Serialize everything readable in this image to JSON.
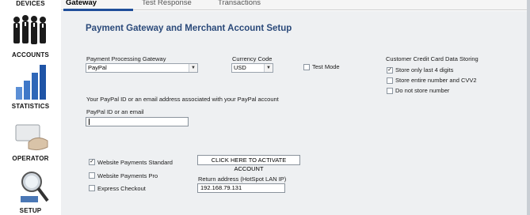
{
  "nav": {
    "items": [
      {
        "label": "DEVICES"
      },
      {
        "label": "ACCOUNTS"
      },
      {
        "label": "STATISTICS"
      },
      {
        "label": "OPERATOR"
      },
      {
        "label": "SETUP"
      }
    ]
  },
  "tabs": [
    {
      "label": "Gateway",
      "active": true
    },
    {
      "label": "Test Response",
      "active": false
    },
    {
      "label": "Transactions",
      "active": false
    }
  ],
  "page": {
    "title": "Payment Gateway and Merchant Account Setup"
  },
  "gateway": {
    "label": "Payment Processing Gateway",
    "value": "PayPal"
  },
  "currency": {
    "label": "Currency Code",
    "value": "USD"
  },
  "test_mode": {
    "label": "Test Mode",
    "checked": false
  },
  "card_storing": {
    "label": "Customer Credit Card Data Storing",
    "options": [
      {
        "label": "Store only last 4 digits",
        "checked": true
      },
      {
        "label": "Store entire number and CVV2",
        "checked": false
      },
      {
        "label": "Do not store number",
        "checked": false
      }
    ]
  },
  "paypal": {
    "instruction": "Your PayPal ID or an email address associated with your PayPal account",
    "id_label": "PayPal ID or an email",
    "id_value": ""
  },
  "payments": [
    {
      "label": "Website Payments Standard",
      "checked": true
    },
    {
      "label": "Website Payments Pro",
      "checked": false
    },
    {
      "label": "Express Checkout",
      "checked": false
    }
  ],
  "activate_button": "CLICK HERE TO ACTIVATE ACCOUNT",
  "return_address": {
    "label": "Return address (HotSpot LAN IP)",
    "value": "192.168.79.131"
  }
}
